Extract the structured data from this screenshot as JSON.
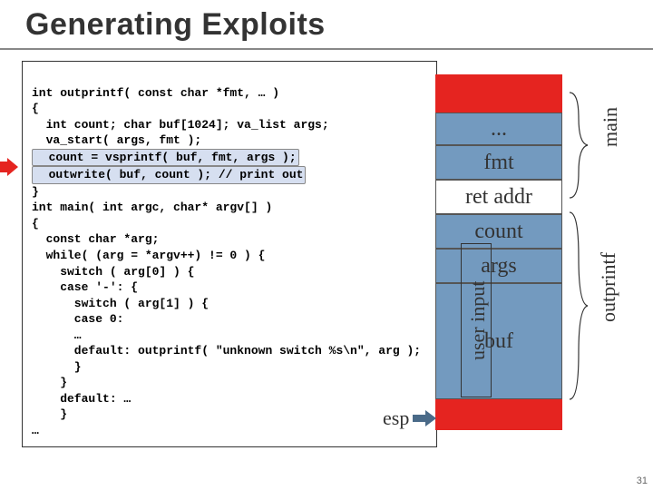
{
  "title": "Generating Exploits",
  "code": {
    "l1": "int outprintf( const char *fmt, … )",
    "l2": "{",
    "l3": "  int count; char buf[1024]; va_list args;",
    "l4": "  va_start( args, fmt );",
    "l5": "  count = vsprintf( buf, fmt, args );",
    "l6": "  outwrite( buf, count ); // print out",
    "l7": "}",
    "l8": "int main( int argc, char* argv[] )",
    "l9": "{",
    "l10": "  const char *arg;",
    "l11": "  while( (arg = *argv++) != 0 ) {",
    "l12": "    switch ( arg[0] ) {",
    "l13": "    case '-': {",
    "l14": "      switch ( arg[1] ) {",
    "l15": "      case 0:",
    "l16": "      …",
    "l17": "      default: outprintf( \"unknown switch %s\\n\", arg );",
    "l18": "      }",
    "l19": "    }",
    "l20": "    default: …",
    "l21": "    }",
    "l22": "…"
  },
  "stack": {
    "dots": "...",
    "fmt": "fmt",
    "ret": "ret addr",
    "count": "count",
    "args": "args",
    "buf": "buf"
  },
  "labels": {
    "main": "main",
    "outprintf": "outprintf",
    "user_input": "user input",
    "esp": "esp"
  },
  "slide_number": "31"
}
